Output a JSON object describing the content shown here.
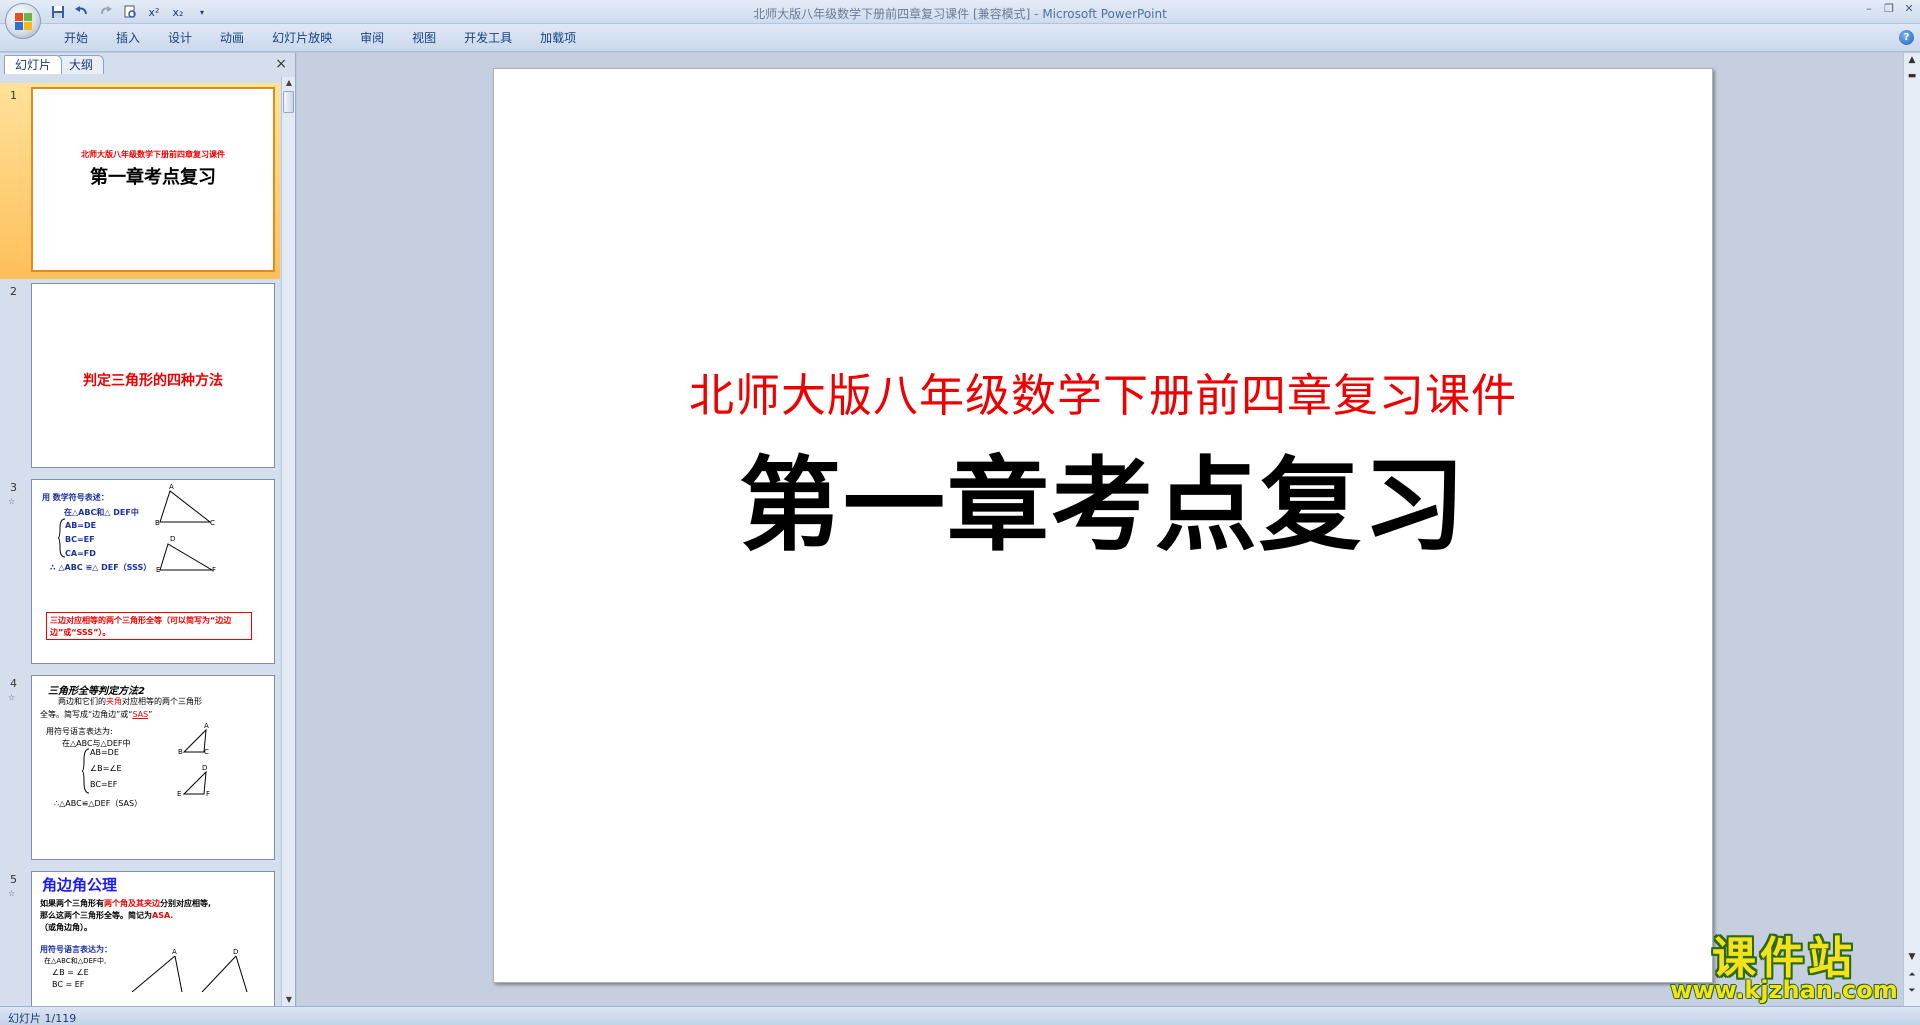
{
  "window": {
    "title_doc": "北师大版八年级数学下册前四章复习课件 [兼容模式] - ",
    "title_app": "Microsoft PowerPoint"
  },
  "quick_access": [
    "save-icon",
    "undo-icon",
    "redo-icon",
    "print-preview-icon",
    "superscript-icon",
    "subscript-icon"
  ],
  "quick_access_labels": {
    "superscript": "x²",
    "subscript": "x₂"
  },
  "ribbon_tabs": [
    "开始",
    "插入",
    "设计",
    "动画",
    "幻灯片放映",
    "审阅",
    "视图",
    "开发工具",
    "加载项"
  ],
  "left_pane": {
    "tabs": [
      "幻灯片",
      "大纲"
    ],
    "close": "×"
  },
  "thumbnails": {
    "t1": {
      "num": "1",
      "subtitle": "北师大版八年级数学下册前四章复习课件",
      "title": "第一章考点复习"
    },
    "t2": {
      "num": "2",
      "title": "判定三角形的四种方法"
    },
    "t3": {
      "num": "3",
      "line1": "用 数学符号表述：",
      "line2": "在△ABC和△ DEF中",
      "line3": "AB=DE",
      "line4": "BC=EF",
      "line5": "CA=FD",
      "line6": "∴ △ABC ≌△ DEF（SSS）",
      "box": "三边对应相等的两个三角形全等（可以简写为“边边边”或“SSS”）。",
      "v_a": "A",
      "v_b": "B",
      "v_c": "C",
      "v_d": "D",
      "v_e": "E",
      "v_f": "F"
    },
    "t4": {
      "num": "4",
      "head": "三角形全等判定方法2",
      "desc1_a": "两边和它们的",
      "desc1_red": "夹角",
      "desc1_b": "对应相等的两个三角形",
      "desc2_a": "全等。简写成“边角边”或“",
      "desc2_red": "SAS",
      "desc2_b": "”",
      "line1": "用符号语言表达为:",
      "line2": "在△ABC与△DEF中",
      "line3": "AB=DE",
      "line4": "∠B=∠E",
      "line5": "BC=EF",
      "line6": "∴△ABC≌△DEF（SAS）",
      "v_a": "A",
      "v_b": "B",
      "v_c": "C",
      "v_d": "D",
      "v_e": "E",
      "v_f": "F"
    },
    "t5": {
      "num": "5",
      "head": "角边角公理",
      "p1_a": "如果两个三角形有",
      "p1_red": "两个角及其夹边",
      "p1_b": "分别对应相等,",
      "p2_a": "那么这两个三角形全等。简记为",
      "p2_red": "ASA.",
      "p3": "（或角边角）。",
      "line1": "用符号语言表达为：",
      "line2": "在△ABC和△DEF中,",
      "line3": "∠B = ∠E",
      "line4": "BC = EF",
      "v_a": "A",
      "v_d": "D"
    }
  },
  "slide": {
    "subtitle": "北师大版八年级数学下册前四章复习课件",
    "title": "第一章考点复习"
  },
  "status": {
    "slide_indicator": "幻灯片 1/119"
  },
  "watermark": {
    "logo": "课件站",
    "url": "www.kjzhan.com"
  },
  "colors": {
    "accent_red": "#ee0000",
    "selected_thumb": "#ffbf5a",
    "text_blue": "#1b2fa3"
  }
}
